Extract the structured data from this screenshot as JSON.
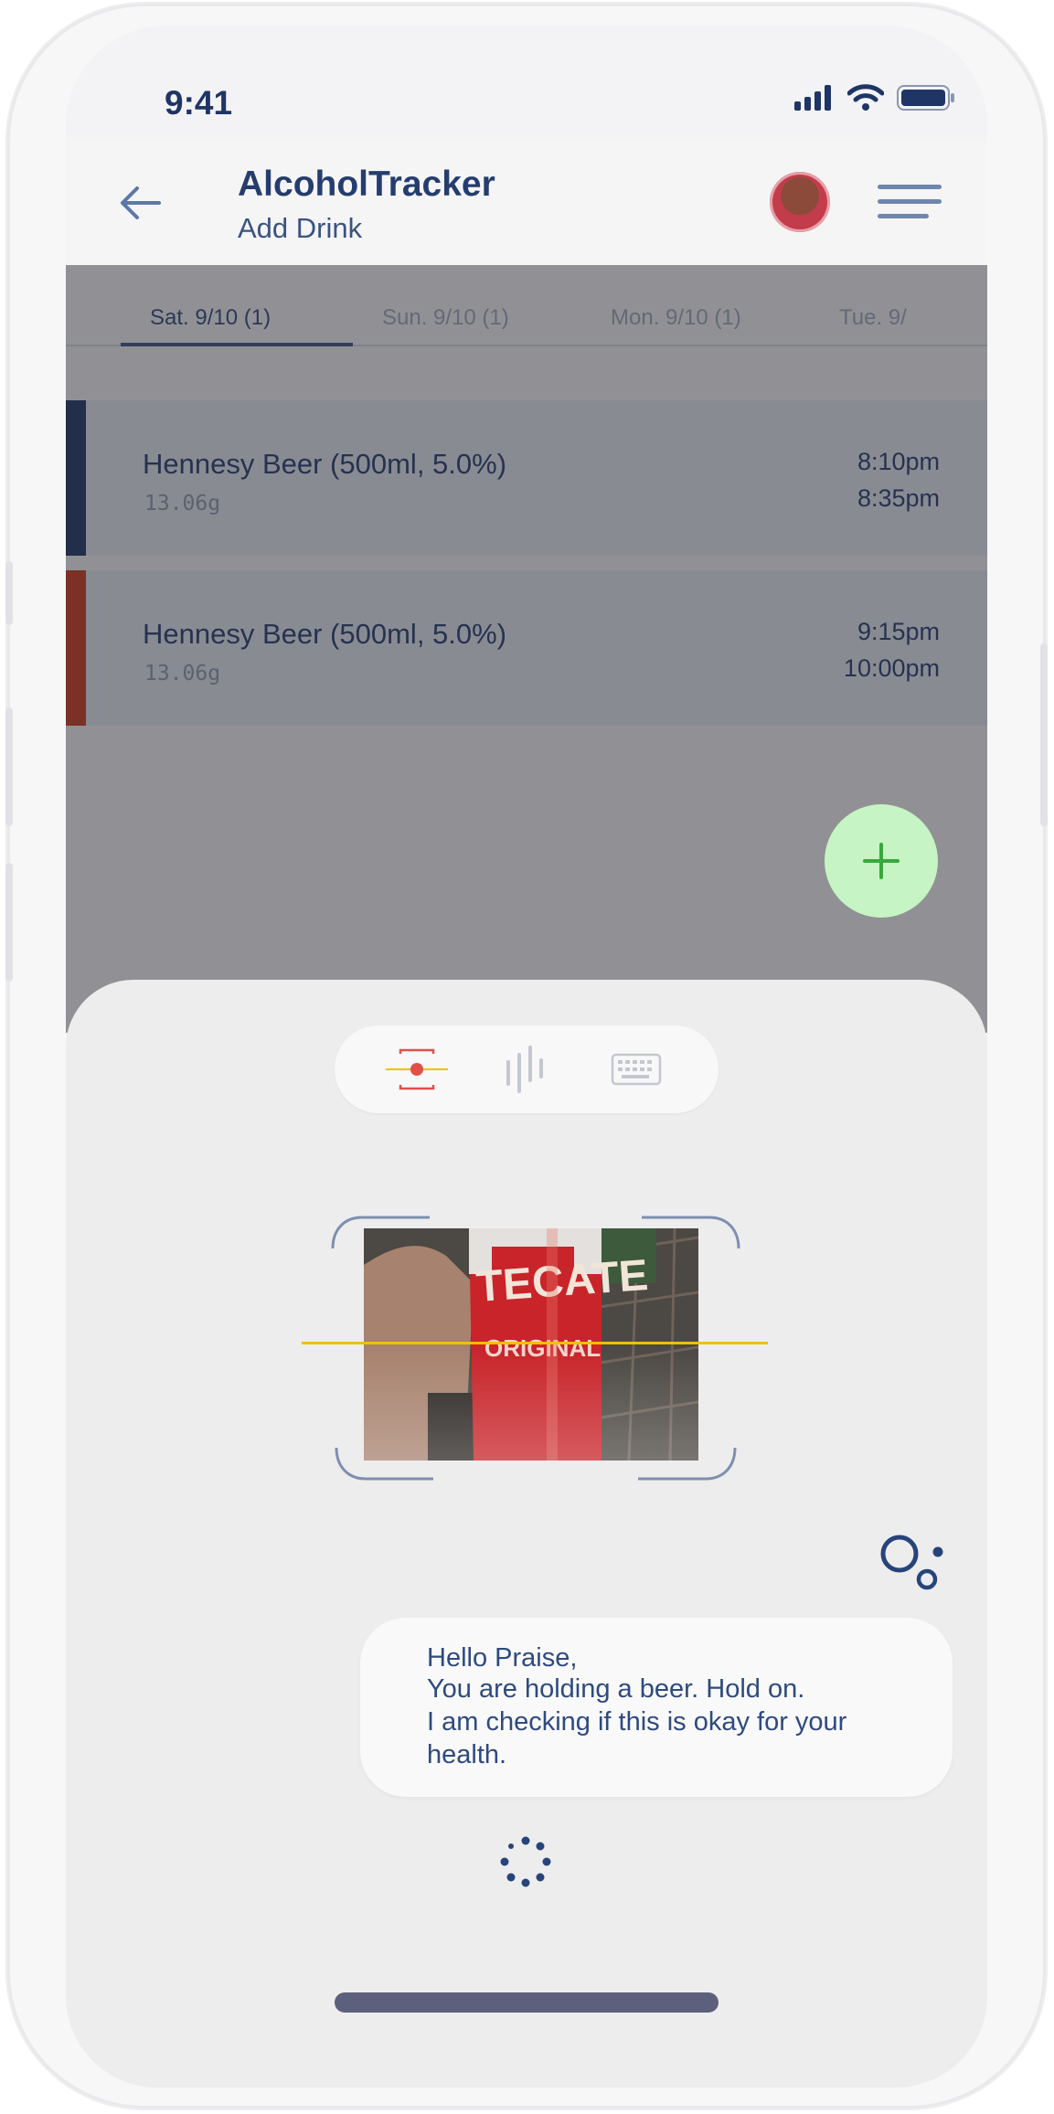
{
  "status": {
    "time": "9:41"
  },
  "header": {
    "title": "AlcoholTracker",
    "subtitle": "Add Drink"
  },
  "tabs": [
    {
      "label": "Sat. 9/10 (1)",
      "active": true
    },
    {
      "label": "Sun. 9/10 (1)",
      "active": false
    },
    {
      "label": "Mon. 9/10 (1)",
      "active": false
    },
    {
      "label": "Tue. 9/",
      "active": false
    }
  ],
  "drinks": [
    {
      "name": "Hennesy Beer (500ml, 5.0%)",
      "grams": "13.06g",
      "start": "8:10pm",
      "end": "8:35pm",
      "accent_color": "#1f3566"
    },
    {
      "name": "Hennesy Beer (500ml, 5.0%)",
      "grams": "13.06g",
      "start": "9:15pm",
      "end": "10:00pm",
      "accent_color": "#c83a1f"
    }
  ],
  "fab": {
    "icon": "plus-icon",
    "color": "#3aa73c"
  },
  "input_modes": [
    {
      "icon": "scan-icon",
      "active": true
    },
    {
      "icon": "voice-icon",
      "active": false
    },
    {
      "icon": "keyboard-icon",
      "active": false
    }
  ],
  "assistant": {
    "message_lines": [
      "Hello Praise,",
      "You are holding a beer. Hold on.",
      "I am checking if this is okay for your",
      "health."
    ]
  },
  "colors": {
    "accent": "#253d6e",
    "scanline": "#f0c000",
    "scan_active": "#e0504a"
  }
}
